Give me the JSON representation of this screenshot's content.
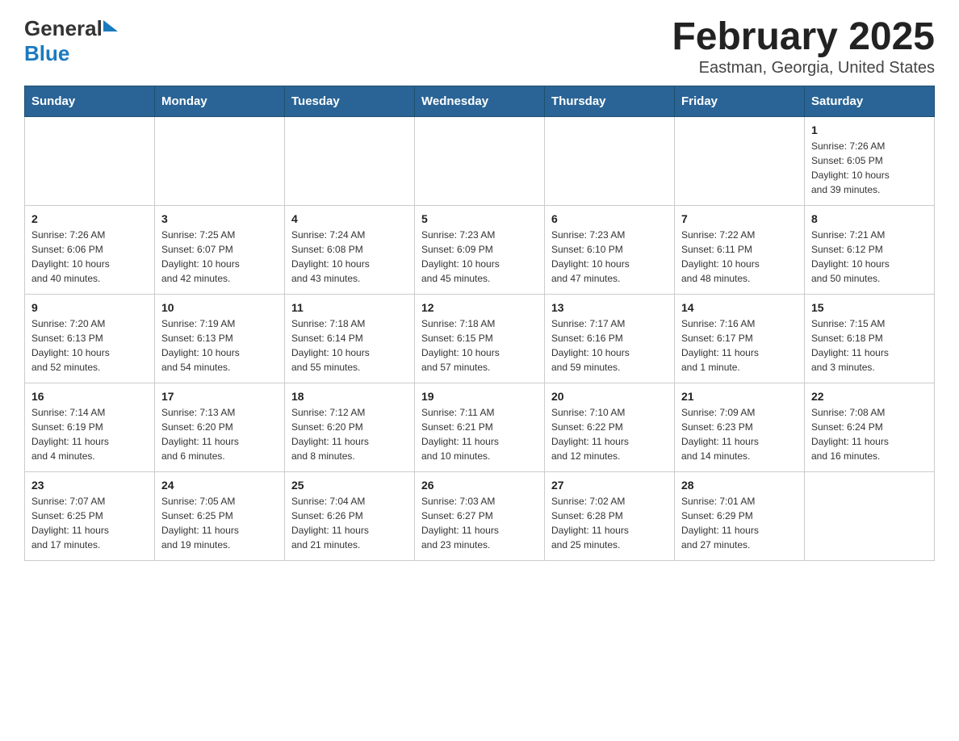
{
  "header": {
    "logo_general": "General",
    "logo_blue": "Blue",
    "title": "February 2025",
    "subtitle": "Eastman, Georgia, United States"
  },
  "days_of_week": [
    "Sunday",
    "Monday",
    "Tuesday",
    "Wednesday",
    "Thursday",
    "Friday",
    "Saturday"
  ],
  "weeks": [
    [
      {
        "day": "",
        "info": ""
      },
      {
        "day": "",
        "info": ""
      },
      {
        "day": "",
        "info": ""
      },
      {
        "day": "",
        "info": ""
      },
      {
        "day": "",
        "info": ""
      },
      {
        "day": "",
        "info": ""
      },
      {
        "day": "1",
        "info": "Sunrise: 7:26 AM\nSunset: 6:05 PM\nDaylight: 10 hours\nand 39 minutes."
      }
    ],
    [
      {
        "day": "2",
        "info": "Sunrise: 7:26 AM\nSunset: 6:06 PM\nDaylight: 10 hours\nand 40 minutes."
      },
      {
        "day": "3",
        "info": "Sunrise: 7:25 AM\nSunset: 6:07 PM\nDaylight: 10 hours\nand 42 minutes."
      },
      {
        "day": "4",
        "info": "Sunrise: 7:24 AM\nSunset: 6:08 PM\nDaylight: 10 hours\nand 43 minutes."
      },
      {
        "day": "5",
        "info": "Sunrise: 7:23 AM\nSunset: 6:09 PM\nDaylight: 10 hours\nand 45 minutes."
      },
      {
        "day": "6",
        "info": "Sunrise: 7:23 AM\nSunset: 6:10 PM\nDaylight: 10 hours\nand 47 minutes."
      },
      {
        "day": "7",
        "info": "Sunrise: 7:22 AM\nSunset: 6:11 PM\nDaylight: 10 hours\nand 48 minutes."
      },
      {
        "day": "8",
        "info": "Sunrise: 7:21 AM\nSunset: 6:12 PM\nDaylight: 10 hours\nand 50 minutes."
      }
    ],
    [
      {
        "day": "9",
        "info": "Sunrise: 7:20 AM\nSunset: 6:13 PM\nDaylight: 10 hours\nand 52 minutes."
      },
      {
        "day": "10",
        "info": "Sunrise: 7:19 AM\nSunset: 6:13 PM\nDaylight: 10 hours\nand 54 minutes."
      },
      {
        "day": "11",
        "info": "Sunrise: 7:18 AM\nSunset: 6:14 PM\nDaylight: 10 hours\nand 55 minutes."
      },
      {
        "day": "12",
        "info": "Sunrise: 7:18 AM\nSunset: 6:15 PM\nDaylight: 10 hours\nand 57 minutes."
      },
      {
        "day": "13",
        "info": "Sunrise: 7:17 AM\nSunset: 6:16 PM\nDaylight: 10 hours\nand 59 minutes."
      },
      {
        "day": "14",
        "info": "Sunrise: 7:16 AM\nSunset: 6:17 PM\nDaylight: 11 hours\nand 1 minute."
      },
      {
        "day": "15",
        "info": "Sunrise: 7:15 AM\nSunset: 6:18 PM\nDaylight: 11 hours\nand 3 minutes."
      }
    ],
    [
      {
        "day": "16",
        "info": "Sunrise: 7:14 AM\nSunset: 6:19 PM\nDaylight: 11 hours\nand 4 minutes."
      },
      {
        "day": "17",
        "info": "Sunrise: 7:13 AM\nSunset: 6:20 PM\nDaylight: 11 hours\nand 6 minutes."
      },
      {
        "day": "18",
        "info": "Sunrise: 7:12 AM\nSunset: 6:20 PM\nDaylight: 11 hours\nand 8 minutes."
      },
      {
        "day": "19",
        "info": "Sunrise: 7:11 AM\nSunset: 6:21 PM\nDaylight: 11 hours\nand 10 minutes."
      },
      {
        "day": "20",
        "info": "Sunrise: 7:10 AM\nSunset: 6:22 PM\nDaylight: 11 hours\nand 12 minutes."
      },
      {
        "day": "21",
        "info": "Sunrise: 7:09 AM\nSunset: 6:23 PM\nDaylight: 11 hours\nand 14 minutes."
      },
      {
        "day": "22",
        "info": "Sunrise: 7:08 AM\nSunset: 6:24 PM\nDaylight: 11 hours\nand 16 minutes."
      }
    ],
    [
      {
        "day": "23",
        "info": "Sunrise: 7:07 AM\nSunset: 6:25 PM\nDaylight: 11 hours\nand 17 minutes."
      },
      {
        "day": "24",
        "info": "Sunrise: 7:05 AM\nSunset: 6:25 PM\nDaylight: 11 hours\nand 19 minutes."
      },
      {
        "day": "25",
        "info": "Sunrise: 7:04 AM\nSunset: 6:26 PM\nDaylight: 11 hours\nand 21 minutes."
      },
      {
        "day": "26",
        "info": "Sunrise: 7:03 AM\nSunset: 6:27 PM\nDaylight: 11 hours\nand 23 minutes."
      },
      {
        "day": "27",
        "info": "Sunrise: 7:02 AM\nSunset: 6:28 PM\nDaylight: 11 hours\nand 25 minutes."
      },
      {
        "day": "28",
        "info": "Sunrise: 7:01 AM\nSunset: 6:29 PM\nDaylight: 11 hours\nand 27 minutes."
      },
      {
        "day": "",
        "info": ""
      }
    ]
  ]
}
